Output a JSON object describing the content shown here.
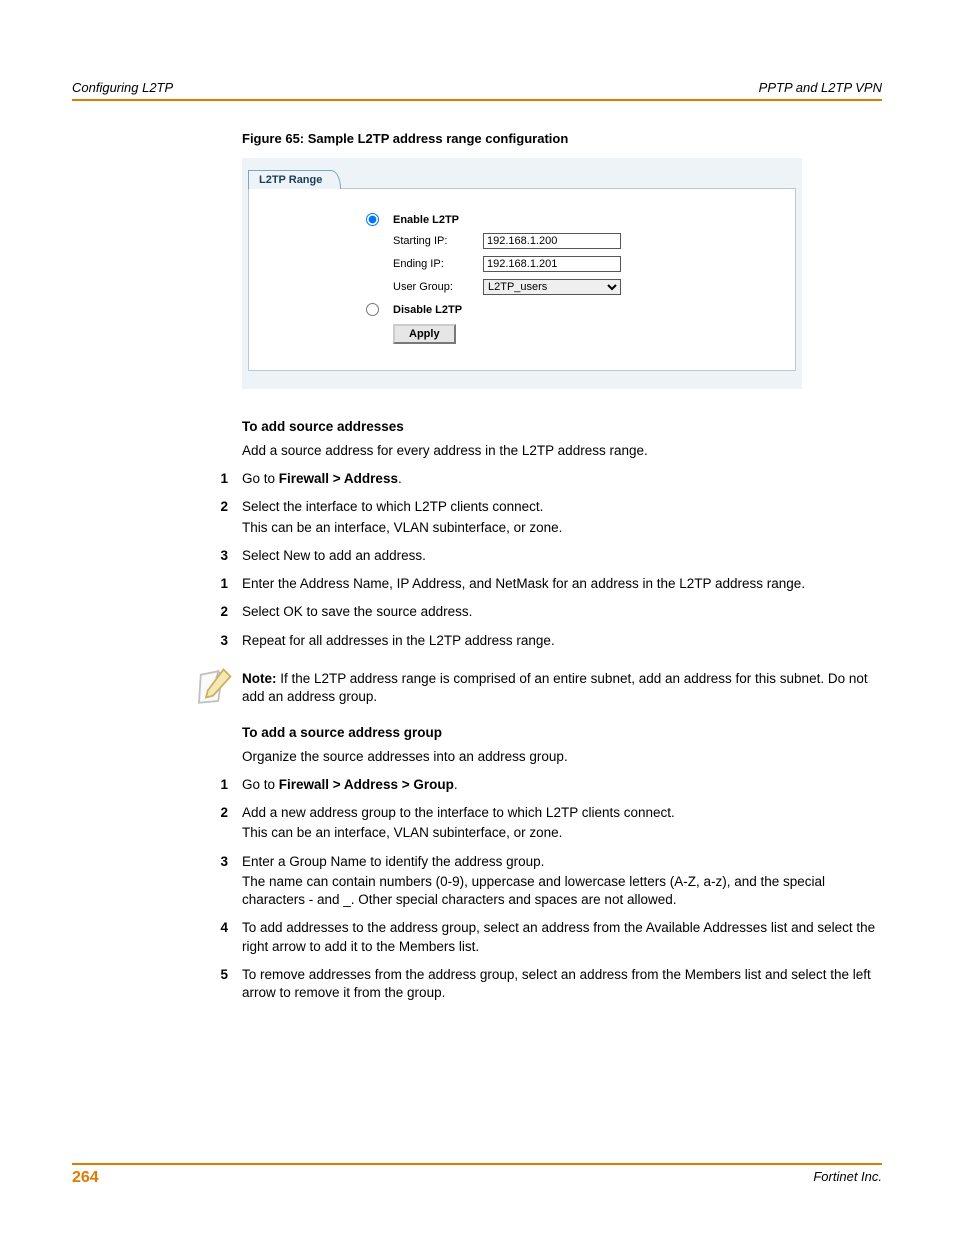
{
  "header": {
    "left": "Configuring L2TP",
    "right": "PPTP and L2TP VPN"
  },
  "figure": {
    "caption": "Figure 65: Sample L2TP address range configuration",
    "tab_label": "L2TP Range",
    "enable_label": "Enable L2TP",
    "starting_ip_label": "Starting IP:",
    "starting_ip_value": "192.168.1.200",
    "ending_ip_label": "Ending IP:",
    "ending_ip_value": "192.168.1.201",
    "user_group_label": "User Group:",
    "user_group_value": "L2TP_users",
    "disable_label": "Disable L2TP",
    "apply_label": "Apply"
  },
  "sectionA": {
    "heading": "To add source addresses",
    "intro": "Add a source address for every address in the L2TP address range.",
    "steps1": [
      {
        "n": "1",
        "parts": [
          {
            "t": "Go to "
          },
          {
            "b": "Firewall > Address"
          },
          {
            "t": "."
          }
        ]
      },
      {
        "n": "2",
        "parts": [
          {
            "t": "Select the interface to which L2TP clients connect."
          }
        ],
        "extra": "This can be an interface, VLAN subinterface, or zone."
      },
      {
        "n": "3",
        "parts": [
          {
            "t": "Select New to add an address."
          }
        ]
      }
    ],
    "steps2": [
      {
        "n": "1",
        "parts": [
          {
            "t": "Enter the Address Name, IP Address, and NetMask for an address in the L2TP address range."
          }
        ]
      },
      {
        "n": "2",
        "parts": [
          {
            "t": "Select OK to save the source address."
          }
        ]
      },
      {
        "n": "3",
        "parts": [
          {
            "t": "Repeat for all addresses in the L2TP address range."
          }
        ]
      }
    ]
  },
  "note": {
    "label": "Note:",
    "text": " If the L2TP address range is comprised of an entire subnet, add an address for this subnet. Do not add an address group."
  },
  "sectionB": {
    "heading": "To add a source address group",
    "intro": "Organize the source addresses into an address group.",
    "steps": [
      {
        "n": "1",
        "parts": [
          {
            "t": "Go to "
          },
          {
            "b": "Firewall > Address > Group"
          },
          {
            "t": "."
          }
        ]
      },
      {
        "n": "2",
        "parts": [
          {
            "t": "Add a new address group to the interface to which L2TP clients connect."
          }
        ],
        "extra": "This can be an interface, VLAN subinterface, or zone."
      },
      {
        "n": "3",
        "parts": [
          {
            "t": "Enter a Group Name to identify the address group."
          }
        ],
        "extra": "The name can contain numbers (0-9), uppercase and lowercase letters (A-Z, a-z), and the special characters - and _. Other special characters and spaces are not allowed."
      },
      {
        "n": "4",
        "parts": [
          {
            "t": "To add addresses to the address group, select an address from the Available Addresses list and select the right arrow to add it to the Members list."
          }
        ]
      },
      {
        "n": "5",
        "parts": [
          {
            "t": "To remove addresses from the address group, select an address from the Members list and select the left arrow to remove it from the group."
          }
        ]
      }
    ]
  },
  "footer": {
    "page": "264",
    "company": "Fortinet Inc."
  }
}
